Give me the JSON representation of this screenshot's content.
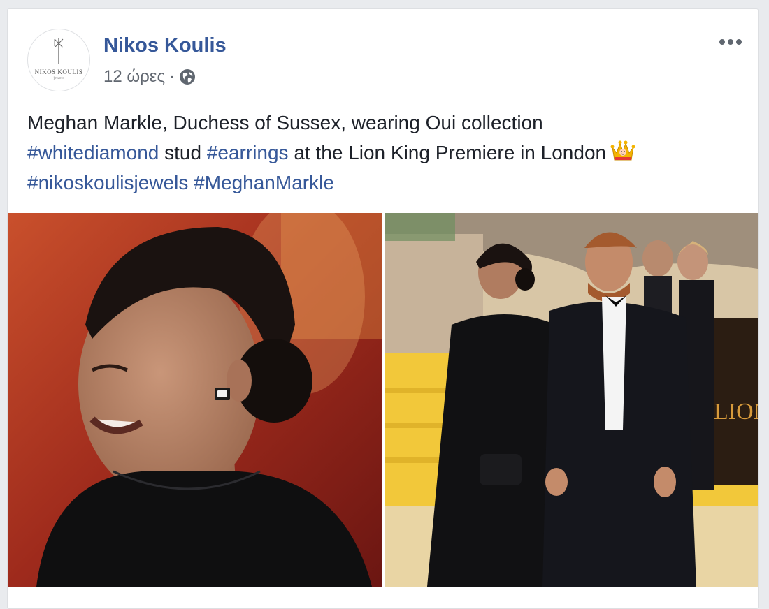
{
  "post": {
    "author": "Nikos Koulis",
    "timestamp": "12 ώρες",
    "separator": "·",
    "privacy_icon": "globe-icon",
    "menu_icon": "more-options-icon",
    "avatar": {
      "logo_text": "NIKOS KOULIS",
      "logo_sub": "jewels"
    },
    "text": {
      "line1": "Meghan Markle, Duchess of Sussex, wearing Oui collection",
      "line2_tag1": "#whitediamond",
      "line2_mid1": " stud ",
      "line2_tag2": "#earrings",
      "line2_mid2": " at the Lion King Premiere in London",
      "line2_emoji": "crown-emoji",
      "line3_tag1": "#nikoskoulisjewels",
      "line3_space": " ",
      "line3_tag2": "#MeghanMarkle"
    },
    "photos": [
      {
        "name": "closeup-portrait"
      },
      {
        "name": "couple-premiere",
        "sign_text": "LION"
      }
    ]
  },
  "colors": {
    "link": "#365899",
    "text": "#1d2129",
    "meta": "#616770"
  }
}
